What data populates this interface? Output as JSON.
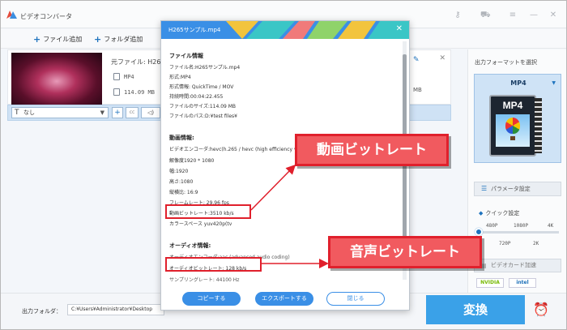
{
  "window": {
    "title": "ビデオコンバータ"
  },
  "toolbar": {
    "add_file": "ファイル追加",
    "add_folder": "フォルダ追加"
  },
  "file_item": {
    "source_label": "元ファイル: H26",
    "format": "MP4",
    "size": "114.09 MB",
    "tail_size": "MB",
    "subtitle": "なし"
  },
  "right_panel": {
    "output_format_title": "出力フォーマットを選択",
    "format": "MP4",
    "format_icon_label": "MP4",
    "param_button": "パラメータ設定",
    "quick_setting": "クイック設定",
    "res_top": [
      "480P",
      "1080P",
      "4K"
    ],
    "res_bottom": [
      "720P",
      "2K"
    ],
    "gpu_button": "ビデオカード加速",
    "chip_nvidia": "NVIDIA",
    "chip_intel": "intel"
  },
  "bottom": {
    "output_folder_label": "出力フォルダ：",
    "output_path": "C:¥Users¥Administrator¥Desktop",
    "convert": "変換"
  },
  "modal": {
    "title": "H265サンプル.mp4",
    "file_info_title": "ファイル情報",
    "file_info": [
      "ファイル名:H265サンプル.mp4",
      "形式:MP4",
      "形式情報: QuickTime / MOV",
      "持続時間:00:04:22.455",
      "ファイルのサイズ:114.09 MB",
      "ファイルのパス:D:¥test files¥"
    ],
    "video_info_title": "動画情報:",
    "video_info": [
      "ビデオエンコーダ:hevc(h.265 / hevc (high efficiency vide",
      "解像度1920 * 1080",
      "幅:1920",
      "高さ:1080",
      "縦横比: 16:9",
      "フレームレート: 29.96 fps",
      "動画ビットレート:3510 kb/s",
      "カラースペース yuv420p(tv"
    ],
    "audio_info_title": "オーディオ情報:",
    "audio_info": [
      "オーディオエンコーダ:aac (advanced audio coding)",
      "オーディオビットレート: 128 kb/s",
      "サンプリングレート: 44100 Hz"
    ],
    "buttons": {
      "copy": "コピーする",
      "export": "エクスポートする",
      "close": "閉じる"
    }
  },
  "annotations": {
    "video_bitrate": "動画ビットレート",
    "audio_bitrate": "音声ビットレート"
  },
  "colors": {
    "accent": "#3a8fe6",
    "convert": "#3aa1e8",
    "callout_fill": "#f15a5f",
    "callout_border": "#e0202c"
  }
}
